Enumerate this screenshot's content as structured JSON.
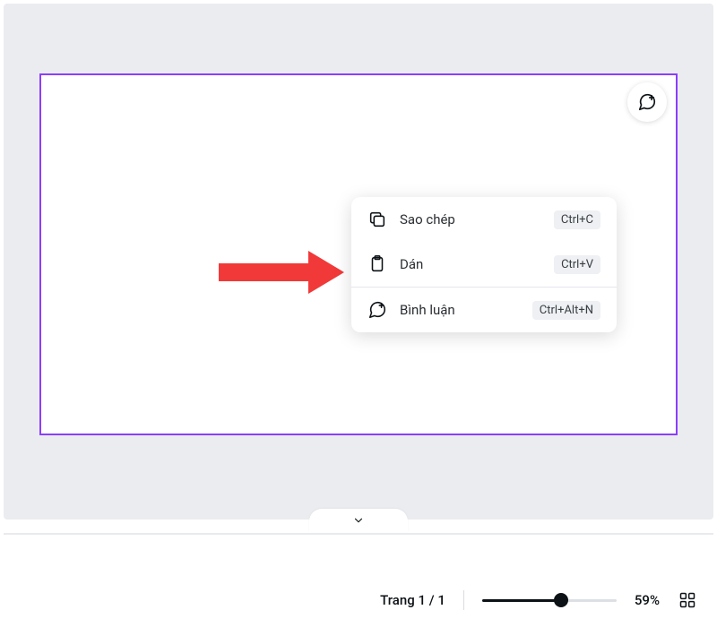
{
  "menu": {
    "items": [
      {
        "label": "Sao chép",
        "shortcut": "Ctrl+C",
        "icon": "copy"
      },
      {
        "label": "Dán",
        "shortcut": "Ctrl+V",
        "icon": "paste"
      },
      {
        "label": "Bình luận",
        "shortcut": "Ctrl+Alt+N",
        "icon": "comment-plus"
      }
    ]
  },
  "footer": {
    "page_prefix": "Trang",
    "page_current": 1,
    "page_total": 1,
    "page_sep": "/",
    "zoom_text": "59%",
    "zoom_percent": 59
  },
  "colors": {
    "selection": "#8b3dff",
    "arrow": "#f13939"
  }
}
